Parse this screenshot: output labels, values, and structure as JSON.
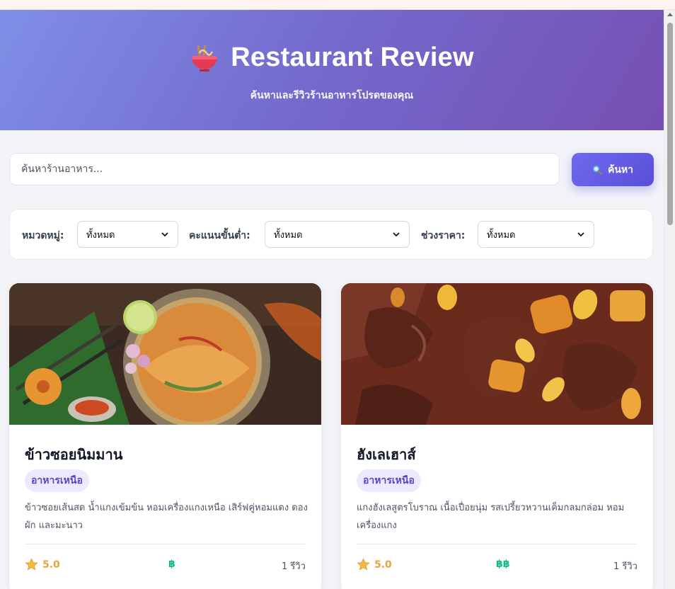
{
  "header": {
    "title": "Restaurant Review",
    "subtitle": "ค้นหาและรีวิวร้านอาหารโปรดของคุณ",
    "logo_icon": "noodle-bowl-icon"
  },
  "search": {
    "placeholder": "ค้นหาร้านอาหาร...",
    "value": "",
    "button_label": "ค้นหา",
    "button_icon": "magnifier-icon"
  },
  "filters": {
    "category": {
      "label": "หมวดหมู่:",
      "selected": "ทั้งหมด"
    },
    "min_rating": {
      "label": "คะแนนขั้นต่ำ:",
      "selected": "ทั้งหมด"
    },
    "price_range": {
      "label": "ช่วงราคา:",
      "selected": "ทั้งหมด"
    }
  },
  "restaurants": [
    {
      "name": "ข้าวซอยนิมมาน",
      "category": "อาหารเหนือ",
      "description": "ข้าวซอยเส้นสด น้ำแกงเข้มข้น หอมเครื่องแกงเหนือ เสิร์ฟคู่หอมแดง ดองผัก และมะนาว",
      "rating": "5.0",
      "price": "฿",
      "reviews": "1 รีวิว",
      "image": "khao-soi-photo"
    },
    {
      "name": "ฮังเลเฮาส์",
      "category": "อาหารเหนือ",
      "description": "แกงฮังเลสูตรโบราณ เนื้อเปื่อยนุ่ม รสเปรี้ยวหวานเค็มกลมกล่อม หอมเครื่องแกง",
      "rating": "5.0",
      "price": "฿฿",
      "reviews": "1 รีวิว",
      "image": "hang-le-curry-photo"
    }
  ],
  "colors": {
    "accent": "#6f69ee",
    "badge_bg": "#ede9fe",
    "badge_text": "#5b45c7",
    "rating": "#e9a23b",
    "price": "#10b981"
  }
}
